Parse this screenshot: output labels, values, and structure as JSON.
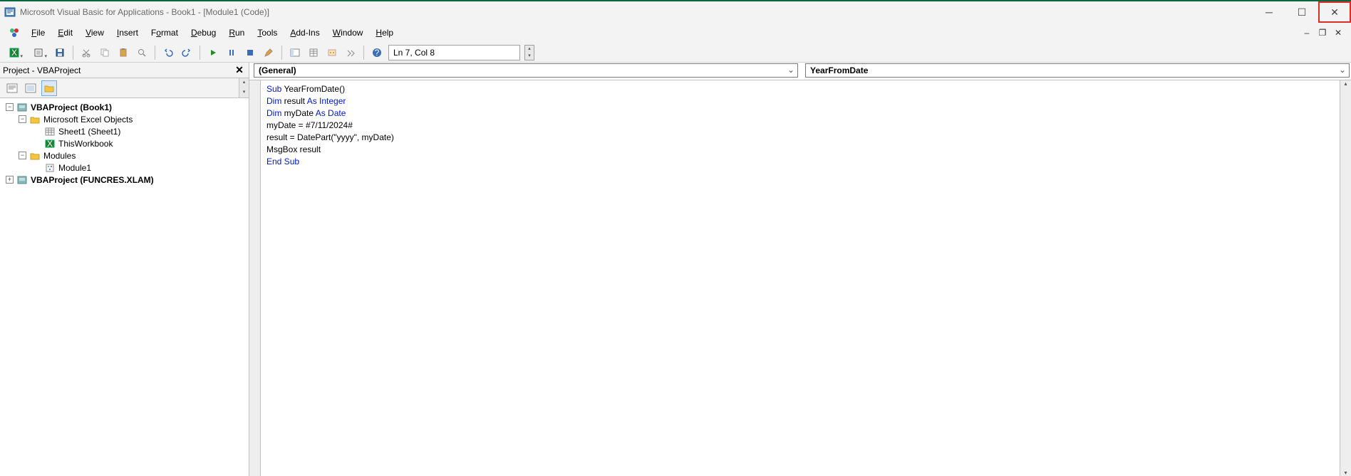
{
  "titlebar": {
    "title": "Microsoft Visual Basic for Applications - Book1 - [Module1 (Code)]"
  },
  "menu": {
    "file": "File",
    "edit": "Edit",
    "view": "View",
    "insert": "Insert",
    "format": "Format",
    "debug": "Debug",
    "run": "Run",
    "tools": "Tools",
    "addins": "Add-Ins",
    "window": "Window",
    "help": "Help"
  },
  "toolbar": {
    "status": "Ln 7, Col 8"
  },
  "project": {
    "title": "Project - VBAProject",
    "tree": {
      "root1": "VBAProject (Book1)",
      "excelObjects": "Microsoft Excel Objects",
      "sheet1": "Sheet1 (Sheet1)",
      "thisWorkbook": "ThisWorkbook",
      "modules": "Modules",
      "module1": "Module1",
      "root2": "VBAProject (FUNCRES.XLAM)"
    }
  },
  "code": {
    "leftCombo": "(General)",
    "rightCombo": "YearFromDate",
    "lines": {
      "l1a": "Sub",
      "l1b": " YearFromDate()",
      "l2a": "Dim",
      "l2b": " result ",
      "l2c": "As Integer",
      "l3a": "Dim",
      "l3b": " myDate ",
      "l3c": "As Date",
      "l4": "myDate = #7/11/2024#",
      "l5": "result = DatePart(\"yyyy\", myDate)",
      "l6": "MsgBox result",
      "l7": "End Sub"
    }
  }
}
